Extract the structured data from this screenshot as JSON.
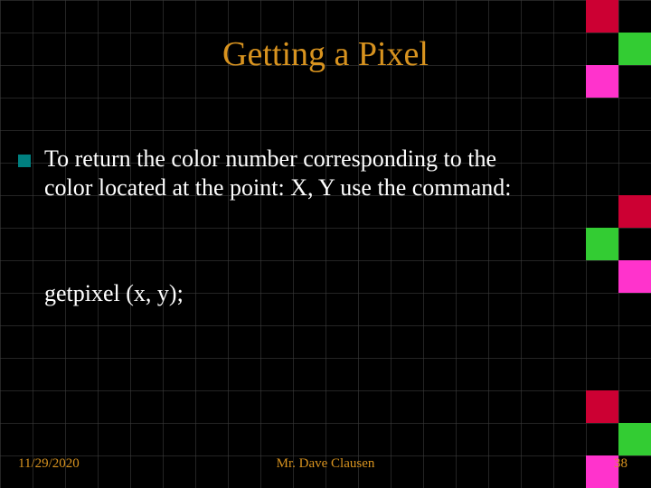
{
  "title": "Getting a Pixel",
  "bullet_icon": "square-bullet-icon",
  "body": "To return the color number corresponding to the color located at the point:  X, Y use the command:",
  "code": "getpixel (x, y);",
  "footer": {
    "date": "11/29/2020",
    "author": "Mr. Dave Clausen",
    "page": "38"
  },
  "colors": {
    "accent": "#d8931f",
    "bullet": "#008080",
    "deco_red": "#cc0033",
    "deco_green": "#33cc33",
    "deco_magenta": "#ff33cc"
  }
}
